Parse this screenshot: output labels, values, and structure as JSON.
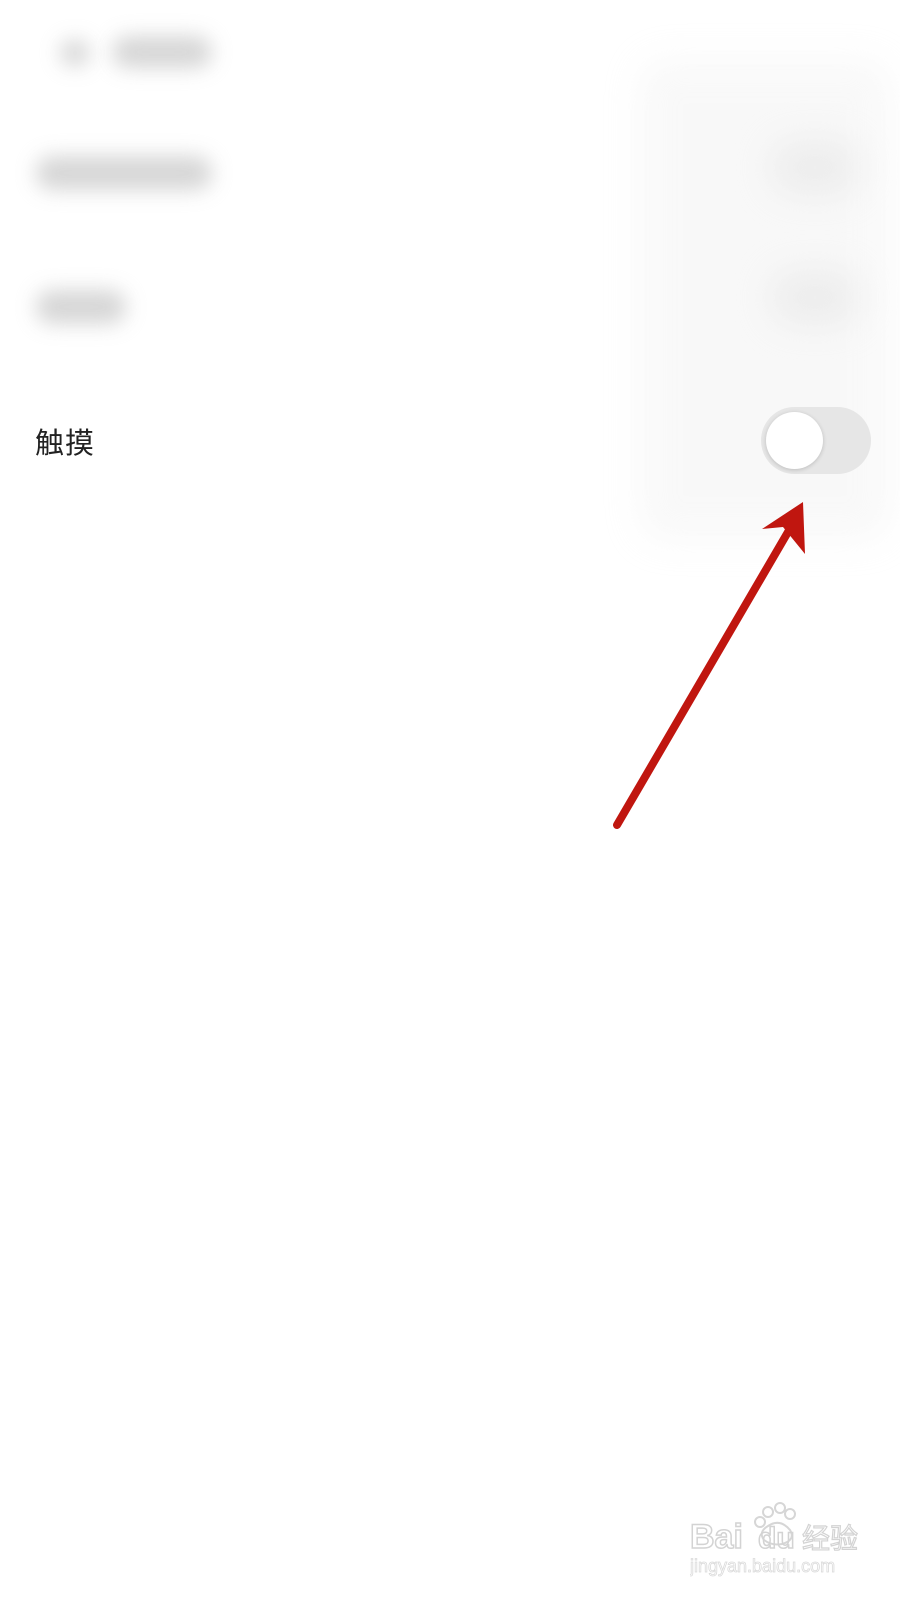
{
  "settings": {
    "touch": {
      "label": "触摸",
      "enabled": false
    }
  },
  "colors": {
    "background": "#ffffff",
    "label_text": "#222222",
    "toggle_track_off": "#e6e6e6",
    "toggle_knob": "#ffffff",
    "annotation_arrow": "#c0160f"
  },
  "watermark": {
    "brand": "Baidu经验",
    "url": "jingyan.baidu.com"
  }
}
